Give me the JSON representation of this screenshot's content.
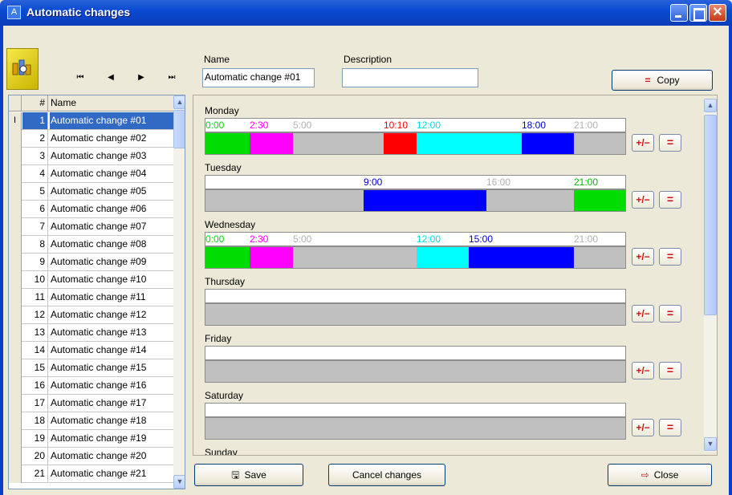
{
  "window": {
    "title": "Automatic changes",
    "app_icon": "A"
  },
  "form": {
    "name_label": "Name",
    "name_value": "Automatic change #01",
    "description_label": "Description",
    "description_value": "",
    "copy_label": "Copy",
    "copy_icon": "="
  },
  "nav": {
    "first": "⏮",
    "prev": "◀",
    "next": "▶",
    "last": "⏭"
  },
  "grid": {
    "col_num": "#",
    "col_name": "Name",
    "cursor_glyph": "I",
    "rows": [
      {
        "num": "1",
        "name": "Automatic change #01"
      },
      {
        "num": "2",
        "name": "Automatic change #02"
      },
      {
        "num": "3",
        "name": "Automatic change #03"
      },
      {
        "num": "4",
        "name": "Automatic change #04"
      },
      {
        "num": "5",
        "name": "Automatic change #05"
      },
      {
        "num": "6",
        "name": "Automatic change #06"
      },
      {
        "num": "7",
        "name": "Automatic change #07"
      },
      {
        "num": "8",
        "name": "Automatic change #08"
      },
      {
        "num": "9",
        "name": "Automatic change #09"
      },
      {
        "num": "10",
        "name": "Automatic change #10"
      },
      {
        "num": "11",
        "name": "Automatic change #11"
      },
      {
        "num": "12",
        "name": "Automatic change #12"
      },
      {
        "num": "13",
        "name": "Automatic change #13"
      },
      {
        "num": "14",
        "name": "Automatic change #14"
      },
      {
        "num": "15",
        "name": "Automatic change #15"
      },
      {
        "num": "16",
        "name": "Automatic change #16"
      },
      {
        "num": "17",
        "name": "Automatic change #17"
      },
      {
        "num": "18",
        "name": "Automatic change #18"
      },
      {
        "num": "19",
        "name": "Automatic change #19"
      },
      {
        "num": "20",
        "name": "Automatic change #20"
      },
      {
        "num": "21",
        "name": "Automatic change #21"
      }
    ]
  },
  "colors": {
    "green": "#00dd00",
    "magenta": "#ff00ff",
    "gray": "#c0c0c0",
    "red": "#ff0000",
    "cyan": "#00ffff",
    "blue": "#0000ff",
    "white": "#ffffff"
  },
  "schedule": {
    "days": [
      {
        "name": "Monday",
        "labels": [
          {
            "text": "0:00",
            "color": "#00dd00",
            "time": 0
          },
          {
            "text": "2:30",
            "color": "#ff00ff",
            "time": 2.5
          },
          {
            "text": "5:00",
            "color": "#b0b0b0",
            "time": 5
          },
          {
            "text": "10:10",
            "color": "#ff0000",
            "time": 10.1667
          },
          {
            "text": "12:00",
            "color": "#00e0e0",
            "time": 12
          },
          {
            "text": "18:00",
            "color": "#0000cc",
            "time": 18
          },
          {
            "text": "21:00",
            "color": "#b0b0b0",
            "time": 21
          }
        ],
        "segments": [
          {
            "start": 0,
            "end": 2.5,
            "color": "#00dd00"
          },
          {
            "start": 2.5,
            "end": 5,
            "color": "#ff00ff"
          },
          {
            "start": 5,
            "end": 10.1667,
            "color": "#c0c0c0"
          },
          {
            "start": 10.1667,
            "end": 12,
            "color": "#ff0000"
          },
          {
            "start": 12,
            "end": 18,
            "color": "#00ffff"
          },
          {
            "start": 18,
            "end": 21,
            "color": "#0000ff"
          },
          {
            "start": 21,
            "end": 24,
            "color": "#c0c0c0"
          }
        ]
      },
      {
        "name": "Tuesday",
        "labels": [
          {
            "text": "9:00",
            "color": "#0000cc",
            "time": 9
          },
          {
            "text": "16:00",
            "color": "#b0b0b0",
            "time": 16
          },
          {
            "text": "21:00",
            "color": "#00bb00",
            "time": 21
          }
        ],
        "segments": [
          {
            "start": 0,
            "end": 9,
            "color": "#c0c0c0"
          },
          {
            "start": 9,
            "end": 16,
            "color": "#0000ff"
          },
          {
            "start": 16,
            "end": 21,
            "color": "#c0c0c0"
          },
          {
            "start": 21,
            "end": 24,
            "color": "#00dd00"
          }
        ]
      },
      {
        "name": "Wednesday",
        "labels": [
          {
            "text": "0:00",
            "color": "#00dd00",
            "time": 0
          },
          {
            "text": "2:30",
            "color": "#ff00ff",
            "time": 2.5
          },
          {
            "text": "5:00",
            "color": "#b0b0b0",
            "time": 5
          },
          {
            "text": "12:00",
            "color": "#00e0e0",
            "time": 12
          },
          {
            "text": "15:00",
            "color": "#0000cc",
            "time": 15
          },
          {
            "text": "21:00",
            "color": "#b0b0b0",
            "time": 21
          }
        ],
        "segments": [
          {
            "start": 0,
            "end": 2.5,
            "color": "#00dd00"
          },
          {
            "start": 2.5,
            "end": 5,
            "color": "#ff00ff"
          },
          {
            "start": 5,
            "end": 12,
            "color": "#c0c0c0"
          },
          {
            "start": 12,
            "end": 15,
            "color": "#00ffff"
          },
          {
            "start": 15,
            "end": 21,
            "color": "#0000ff"
          },
          {
            "start": 21,
            "end": 24,
            "color": "#c0c0c0"
          }
        ]
      },
      {
        "name": "Thursday",
        "labels": [],
        "segments": []
      },
      {
        "name": "Friday",
        "labels": [],
        "segments": []
      },
      {
        "name": "Saturday",
        "labels": [],
        "segments": []
      },
      {
        "name": "Sunday",
        "labels": [],
        "segments": []
      }
    ],
    "edit_button": "+/−",
    "equal_button": "="
  },
  "footer": {
    "save_label": "Save",
    "cancel_label": "Cancel changes",
    "close_label": "Close"
  }
}
